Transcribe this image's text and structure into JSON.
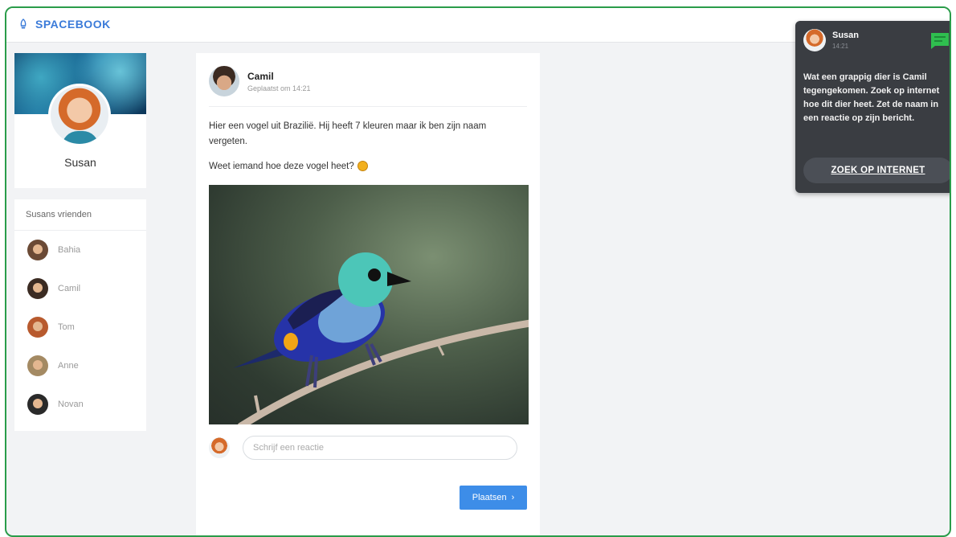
{
  "app": {
    "brand": "SPACEBOOK",
    "accent": "#3b7bd9"
  },
  "profile": {
    "name": "Susan"
  },
  "friends": {
    "title": "Susans vrienden",
    "items": [
      {
        "name": "Bahia",
        "color": "#6b4a35"
      },
      {
        "name": "Camil",
        "color": "#3b2b22"
      },
      {
        "name": "Tom",
        "color": "#b85a2e"
      },
      {
        "name": "Anne",
        "color": "#a48a63"
      },
      {
        "name": "Novan",
        "color": "#2a2a2a"
      }
    ]
  },
  "post": {
    "author": "Camil",
    "time": "Geplaatst om 14:21",
    "text1": "Hier een vogel uit Brazilië. Hij heeft 7 kleuren maar ik ben zijn naam vergeten.",
    "text2": "Weet iemand hoe deze vogel heet?",
    "comment_placeholder": "Schrijf een reactie",
    "submit_label": "Plaatsen"
  },
  "chat": {
    "name": "Susan",
    "time": "14:21",
    "message": "Wat een grappig dier is Camil tegengekomen. Zoek op internet hoe dit dier heet. Zet de naam in een reactie op zijn bericht.",
    "button_label": "ZOEK OP INTERNET",
    "icon_color": "#2fbf4f"
  }
}
